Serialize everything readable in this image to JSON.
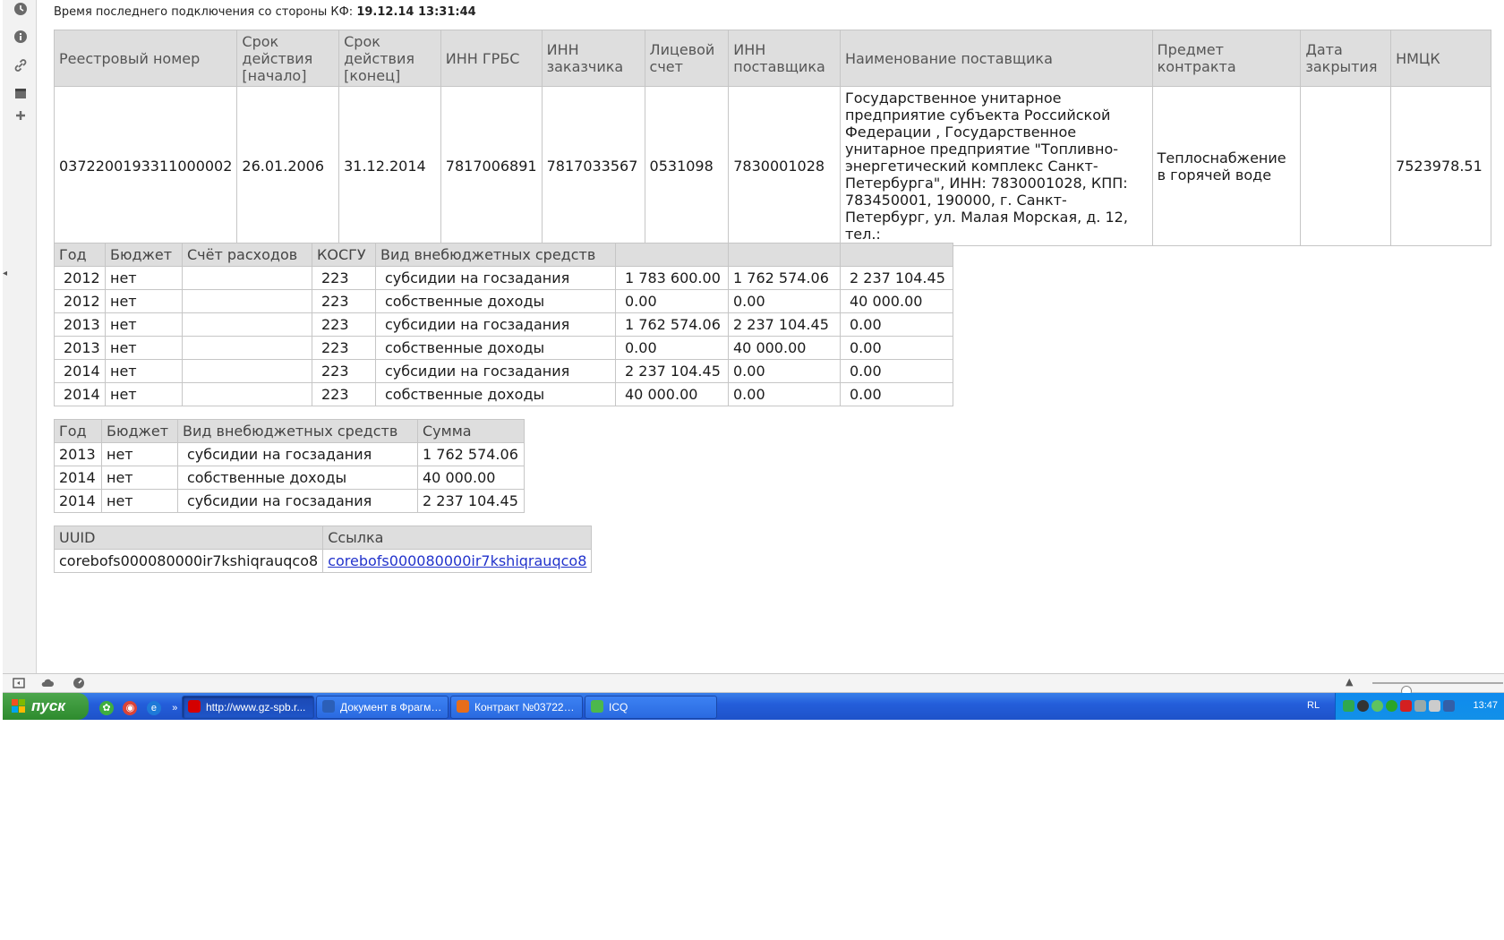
{
  "connection": {
    "label": "Время последнего подключения со стороны КФ:",
    "value": "19.12.14 13:31:44"
  },
  "contract": {
    "headers": [
      "Реестровый номер",
      "Срок действия [начало]",
      "Срок действия [конец]",
      "ИНН ГРБС",
      "ИНН заказчика",
      "Лицевой счет",
      "ИНН поставщика",
      "Наименование поставщика",
      "Предмет контракта",
      "Дата закрытия",
      "НМЦК"
    ],
    "registry_number": "0372200193311000002",
    "start_date": "26.01.2006",
    "end_date": "31.12.2014",
    "inn_grbs": "7817006891",
    "inn_customer": "7817033567",
    "account": "0531098",
    "inn_supplier": "7830001028",
    "supplier_name": "Государственное унитарное предприятие субъекта Российской Федерации , Государственное унитарное предприятие \"Топливно-энергетический комплекс Санкт-Петербурга\", ИНН: 7830001028, КПП: 783450001, 190000, г. Санкт-Петербург, ул. Малая Морская, д. 12, тел.:",
    "subject": "Теплоснабжение в горячей воде",
    "close_date": "",
    "nmck": "7523978.51"
  },
  "finance": {
    "headers": [
      "Год",
      "Бюджет",
      "Счёт расходов",
      "КОСГУ",
      "Вид внебюджетных средств",
      "",
      "",
      ""
    ],
    "rows": [
      [
        "2012",
        "нет",
        "",
        "223",
        "субсидии на госзадания",
        "1 783 600.00",
        "1 762 574.06",
        "2 237 104.45"
      ],
      [
        "2012",
        "нет",
        "",
        "223",
        "собственные доходы",
        "0.00",
        "0.00",
        "40 000.00"
      ],
      [
        "2013",
        "нет",
        "",
        "223",
        "субсидии на госзадания",
        "1 762 574.06",
        "2 237 104.45",
        "0.00"
      ],
      [
        "2013",
        "нет",
        "",
        "223",
        "собственные доходы",
        "0.00",
        "40 000.00",
        "0.00"
      ],
      [
        "2014",
        "нет",
        "",
        "223",
        "субсидии на госзадания",
        "2 237 104.45",
        "0.00",
        "0.00"
      ],
      [
        "2014",
        "нет",
        "",
        "223",
        "собственные доходы",
        "40 000.00",
        "0.00",
        "0.00"
      ]
    ]
  },
  "sums": {
    "headers": [
      "Год",
      "Бюджет",
      "Вид внебюджетных средств",
      "Сумма"
    ],
    "rows": [
      [
        "2013",
        "нет",
        "субсидии на госзадания",
        "1 762 574.06"
      ],
      [
        "2014",
        "нет",
        "собственные доходы",
        "40 000.00"
      ],
      [
        "2014",
        "нет",
        "субсидии на госзадания",
        "2 237 104.45"
      ]
    ]
  },
  "uuid": {
    "headers": [
      "UUID",
      "Ссылка"
    ],
    "value": "corebofs000080000ir7kshiqrauqco8",
    "link": "corebofs000080000ir7kshiqrauqco8"
  },
  "zoom_level": 0.25,
  "taskbar": {
    "start_label": "пуск",
    "tasks": [
      {
        "label": "http://www.gz-spb.r...",
        "icon": "opera-icon",
        "color": "#d40000"
      },
      {
        "label": "Документ в Фрагме...",
        "icon": "word-icon",
        "color": "#2b5fb8"
      },
      {
        "label": "Контракт №037220...",
        "icon": "firefox-icon",
        "color": "#e76d1a"
      },
      {
        "label": "ICQ",
        "icon": "icq-icon",
        "color": "#4cb84c"
      }
    ],
    "lang": "RL",
    "clock": "13:47"
  },
  "colors": {
    "header_bg": "#dedede",
    "border": "#c6c6c6",
    "link": "#2233cc",
    "taskbar": "#245edb",
    "start": "#2e8b2e"
  }
}
